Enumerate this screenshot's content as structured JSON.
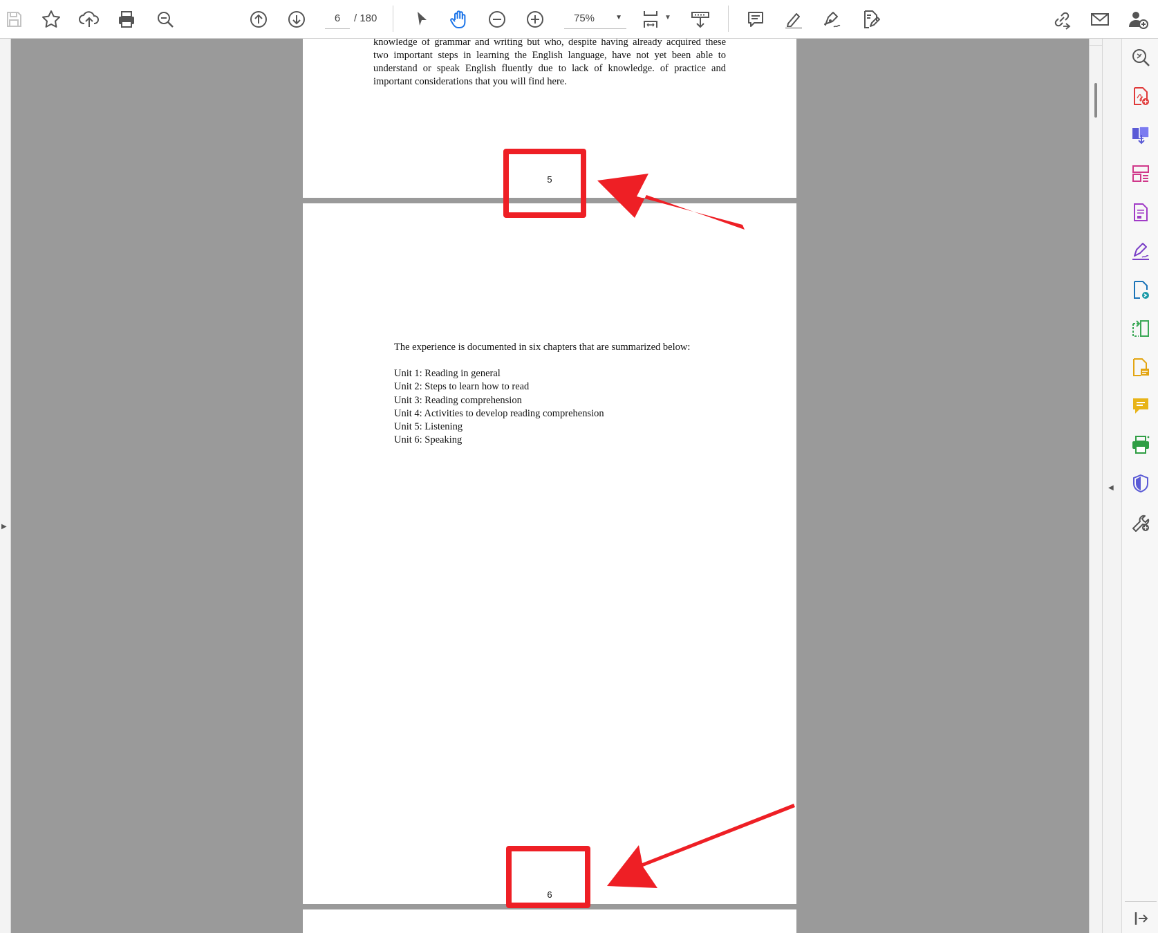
{
  "toolbar": {
    "icons": [
      "save-icon",
      "bookmark-star-icon",
      "upload-cloud-icon",
      "print-icon",
      "zoom-search-icon",
      "previous-page-icon",
      "next-page-icon",
      "select-arrow-icon",
      "hand-tool-icon",
      "zoom-out-icon",
      "zoom-in-icon",
      "fit-page-icon",
      "scroll-mode-icon",
      "comment-icon",
      "highlight-icon",
      "sign-icon",
      "edit-pdf-icon",
      "share-link-icon",
      "email-icon",
      "add-user-icon"
    ],
    "page_current": "6",
    "page_total": "/ 180",
    "zoom": "75%",
    "accent_color": "#1a73e8"
  },
  "document": {
    "prev_page_text_lines": [
      "knowledge of grammar and writing but who, despite having already acquired these",
      "two important steps in learning the English language, have not yet been able to",
      "understand or speak English fluently due to lack of knowledge. of practice and",
      "important considerations that you will find here."
    ],
    "page_number_prev": "5",
    "intro": "The experience is documented in six chapters that are summarized below:",
    "units": [
      "Unit 1: Reading in general",
      "Unit 2: Steps to learn how to read",
      "Unit 3: Reading comprehension",
      "Unit 4: Activities to develop reading comprehension",
      "Unit 5: Listening",
      "Unit 6: Speaking"
    ],
    "page_number_current": "6"
  },
  "annotations": {
    "highlight_color": "#ee1f25"
  },
  "right_tools": [
    "enhance-scan-icon",
    "create-pdf-icon",
    "export-pdf-icon",
    "organize-pages-icon",
    "fill-form-icon",
    "fill-sign-icon",
    "send-for-review-icon",
    "compare-icon",
    "request-signature-icon",
    "add-comment-icon",
    "print-production-icon",
    "protect-icon",
    "more-tools-icon",
    "collapse-panel-icon"
  ]
}
